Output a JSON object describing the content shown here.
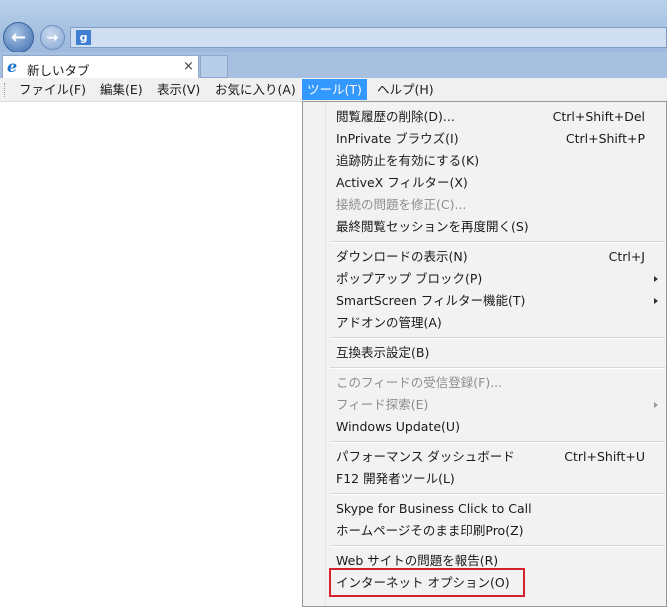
{
  "address": {
    "icon": "google-favicon",
    "text": ""
  },
  "tab": {
    "title": "新しいタブ",
    "icon": "ie-icon",
    "close": "×"
  },
  "menubar": [
    "ファイル(F)",
    "編集(E)",
    "表示(V)",
    "お気に入り(A)",
    "ツール(T)",
    "ヘルプ(H)"
  ],
  "tools_menu": {
    "groups": [
      [
        {
          "label": "閲覧履歴の削除(D)...",
          "shortcut": "Ctrl+Shift+Del"
        },
        {
          "label": "InPrivate ブラウズ(I)",
          "shortcut": "Ctrl+Shift+P"
        },
        {
          "label": "追跡防止を有効にする(K)",
          "shortcut": ""
        },
        {
          "label": "ActiveX フィルター(X)",
          "shortcut": ""
        },
        {
          "label": "接続の問題を修正(C)...",
          "shortcut": "",
          "disabled": true
        },
        {
          "label": "最終閲覧セッションを再度開く(S)",
          "shortcut": ""
        }
      ],
      [
        {
          "label": "ダウンロードの表示(N)",
          "shortcut": "Ctrl+J"
        },
        {
          "label": "ポップアップ ブロック(P)",
          "shortcut": "",
          "submenu": true
        },
        {
          "label": "SmartScreen フィルター機能(T)",
          "shortcut": "",
          "submenu": true
        },
        {
          "label": "アドオンの管理(A)",
          "shortcut": ""
        }
      ],
      [
        {
          "label": "互換表示設定(B)",
          "shortcut": ""
        }
      ],
      [
        {
          "label": "このフィードの受信登録(F)...",
          "shortcut": "",
          "disabled": true
        },
        {
          "label": "フィード探索(E)",
          "shortcut": "",
          "disabled": true,
          "submenu": true
        },
        {
          "label": "Windows Update(U)",
          "shortcut": ""
        }
      ],
      [
        {
          "label": "パフォーマンス ダッシュボード",
          "shortcut": "Ctrl+Shift+U"
        },
        {
          "label": "F12 開発者ツール(L)",
          "shortcut": ""
        }
      ],
      [
        {
          "label": "Skype for Business Click to Call",
          "shortcut": ""
        },
        {
          "label": "ホームページそのまま印刷Pro(Z)",
          "shortcut": ""
        }
      ],
      [
        {
          "label": "Web サイトの問題を報告(R)",
          "shortcut": ""
        },
        {
          "label": "インターネット オプション(O)",
          "shortcut": ""
        }
      ]
    ]
  },
  "colors": {
    "menu_active": "#3399ff",
    "highlight_box": "#d5232b"
  }
}
